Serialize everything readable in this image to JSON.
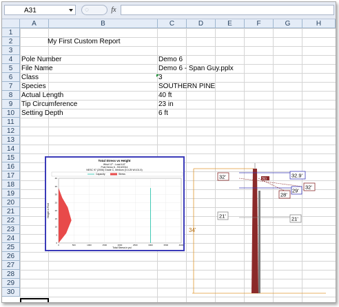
{
  "formula_bar": {
    "name_box": "A31",
    "fx_label": "fx",
    "formula_value": ""
  },
  "columns": [
    "A",
    "B",
    "C",
    "D",
    "E",
    "F",
    "G",
    "H"
  ],
  "rows": [
    "1",
    "2",
    "3",
    "4",
    "5",
    "6",
    "7",
    "8",
    "9",
    "10",
    "11",
    "12",
    "13",
    "14",
    "15",
    "16",
    "17",
    "18",
    "19",
    "20",
    "21",
    "22",
    "23",
    "24",
    "25",
    "26",
    "27",
    "28",
    "29",
    "30"
  ],
  "report": {
    "title": "My First Custom Report",
    "fields": [
      {
        "label": "Pole Number",
        "value": "Demo 6"
      },
      {
        "label": "File Name",
        "value": "Demo 6 - Span Guy.pplx"
      },
      {
        "label": "Class",
        "value": "3"
      },
      {
        "label": "Species",
        "value": "SOUTHERN PINE"
      },
      {
        "label": "Actual Length",
        "value": "40 ft"
      },
      {
        "label": "Tip Circumference",
        "value": "23 in"
      },
      {
        "label": "Setting Depth",
        "value": "6 ft"
      }
    ]
  },
  "colors": {
    "accent": "#3a3ab8",
    "pole": "#8b2a2a",
    "stress_fill": "#e84a4a",
    "capacity_line": "#40c8b4",
    "dim_line": "#e09830"
  },
  "chart_data": {
    "type": "area",
    "title": "Total Stress vs Height",
    "subtitle_lines": [
      "Wind 12° : Load 6.6°",
      "Pole Demo 6 - 9/10/2014",
      "NESC 97 (2006) Grade C, Medium (0.0.25 W:101.5)"
    ],
    "legend": [
      "Capacity",
      "Stress"
    ],
    "xlabel": "Total Stress in psi",
    "ylabel": "Height in Feet",
    "x_ticks": [
      "0",
      "500",
      "1000",
      "1500",
      "2000",
      "2500",
      "3000",
      "3500",
      "4000"
    ],
    "y_ticks": [
      "0",
      "5",
      "10",
      "15",
      "20",
      "25",
      "30",
      "35",
      "40"
    ],
    "xlim": [
      0,
      4000
    ],
    "ylim": [
      0,
      40
    ],
    "series": [
      {
        "name": "Capacity",
        "points": [
          [
            3000,
            0
          ],
          [
            3000,
            34
          ]
        ]
      },
      {
        "name": "Stress",
        "points": [
          [
            0,
            0
          ],
          [
            250,
            6
          ],
          [
            420,
            14
          ],
          [
            300,
            22
          ],
          [
            120,
            28
          ],
          [
            0,
            34
          ]
        ]
      }
    ]
  },
  "pole_diagram": {
    "overall_height_label": "34'",
    "labels": [
      "32'",
      "32.9'",
      "32'",
      "29'",
      "28'",
      "21'",
      "21'"
    ],
    "attachment_label": "3⊡"
  }
}
